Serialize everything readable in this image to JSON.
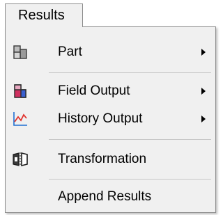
{
  "menubar": {
    "tab_label": "Results"
  },
  "menu": {
    "items": [
      {
        "label": "Part",
        "icon": "part-icon",
        "has_submenu": true
      },
      {
        "label": "Field Output",
        "icon": "field-output-icon",
        "has_submenu": true
      },
      {
        "label": "History Output",
        "icon": "history-output-icon",
        "has_submenu": true
      },
      {
        "label": "Transformation",
        "icon": "transformation-icon",
        "has_submenu": false
      },
      {
        "label": "Append Results",
        "icon": "",
        "has_submenu": false
      }
    ]
  },
  "colors": {
    "menu_background": "#f0f0f0",
    "border": "#8c8c8c",
    "separator": "#c8c8c8",
    "field_output_accent": "#d03060",
    "history_output_line": "#e0302a",
    "history_output_axis": "#1f6fd1"
  }
}
